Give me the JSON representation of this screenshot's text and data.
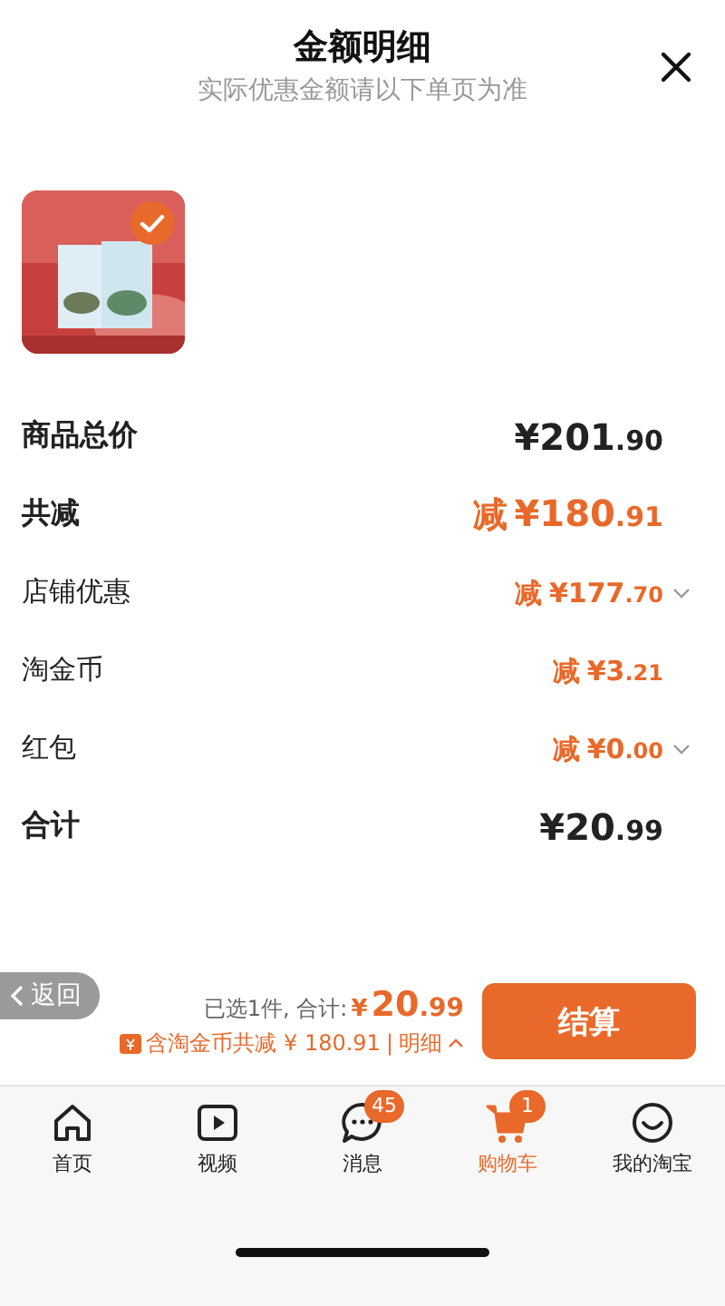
{
  "header": {
    "title": "金额明细",
    "subtitle": "实际优惠金额请以下单页为准"
  },
  "product": {
    "kind": "picture",
    "selected": true
  },
  "rows": [
    {
      "kind": "total",
      "label": "商品总价",
      "amount_main": "¥201",
      "amount_cents": ".90",
      "expandable": false
    },
    {
      "kind": "discount",
      "label": "共减",
      "prefix": "减",
      "amount_main": "¥180",
      "amount_cents": ".91",
      "expandable": false
    },
    {
      "kind": "detail",
      "label": "店铺优惠",
      "prefix": "减",
      "amount_main": "¥177",
      "amount_cents": ".70",
      "expandable": true
    },
    {
      "kind": "detail",
      "label": "淘金币",
      "prefix": "减",
      "amount_main": "¥3",
      "amount_cents": ".21",
      "expandable": false
    },
    {
      "kind": "detail",
      "label": "红包",
      "prefix": "减",
      "amount_main": "¥0",
      "amount_cents": ".00",
      "expandable": true
    },
    {
      "kind": "total",
      "label": "合计",
      "amount_main": "¥20",
      "amount_cents": ".99",
      "expandable": false
    }
  ],
  "back_button": "返回",
  "summary": {
    "selected_text": "已选1件, 合计:",
    "currency": "¥",
    "amount_main": "20",
    "amount_cents": ".99",
    "savings_text": "含淘金币共减 ¥ 180.91",
    "separator": "|",
    "details_link": "明细",
    "checkout_button": "结算"
  },
  "tabs": [
    {
      "label": "首页",
      "selected": false
    },
    {
      "label": "视频",
      "selected": false
    },
    {
      "label": "消息",
      "badge": "45",
      "selected": false
    },
    {
      "label": "购物车",
      "badge": "1",
      "selected": true
    },
    {
      "label": "我的淘宝",
      "selected": false
    }
  ]
}
